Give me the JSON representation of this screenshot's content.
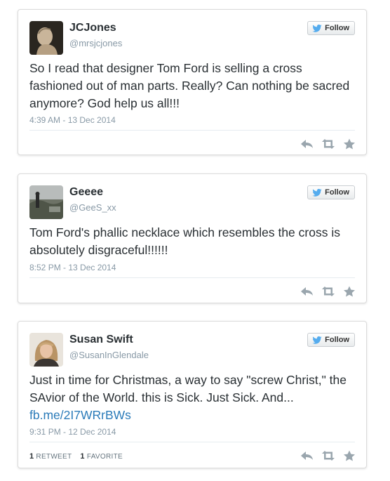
{
  "colors": {
    "accent": "#55acee",
    "link": "#2b7bb9",
    "muted": "#8899a6",
    "text": "#292f33"
  },
  "icons": [
    "twitter-bird-icon",
    "reply-icon",
    "retweet-icon",
    "favorite-icon"
  ],
  "tweets": [
    {
      "name": "JCJones",
      "handle": "@mrsjcjones",
      "follow_label": "Follow",
      "text": "So I read that designer Tom Ford is selling a cross fashioned out of man parts. Really? Can nothing be sacred anymore? God help us all!!!",
      "link": "",
      "timestamp": "4:39 AM - 13 Dec 2014"
    },
    {
      "name": "Geeee",
      "handle": "@GeeS_xx",
      "follow_label": "Follow",
      "text": "Tom Ford's phallic necklace which resembles the cross is absolutely disgraceful!!!!!!",
      "link": "",
      "timestamp": "8:52 PM - 13 Dec 2014"
    },
    {
      "name": "Susan Swift",
      "handle": "@SusanInGlendale",
      "follow_label": "Follow",
      "text": "Just in time for Christmas, a way to say \"screw Christ,\" the SAvior of the World.  this is Sick.  Just Sick.  And...",
      "link": "fb.me/2I7WRrBWs",
      "timestamp": "9:31 PM - 12 Dec 2014",
      "retweet_count": "1",
      "retweet_label": "RETWEET",
      "favorite_count": "1",
      "favorite_label": "FAVORITE"
    }
  ]
}
